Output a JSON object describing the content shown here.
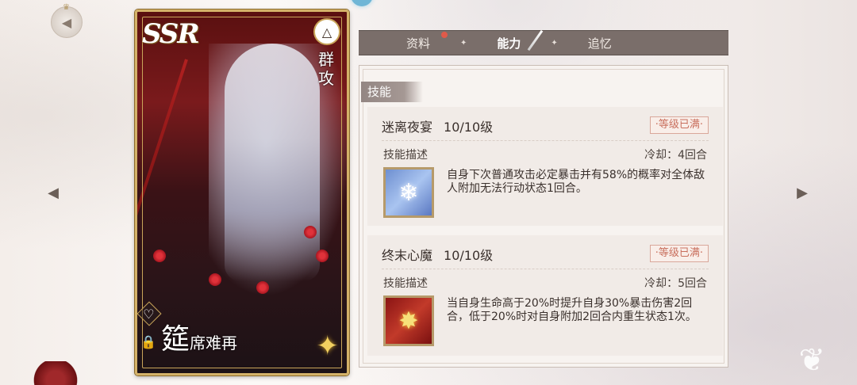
{
  "nav": {
    "back_icon": "back-arrow-icon",
    "prev_icon": "prev-arrow-icon",
    "next_icon": "next-arrow-icon",
    "back_glyph": "◀",
    "prev_glyph": "◀",
    "next_glyph": "▶"
  },
  "card": {
    "rarity": "SSR",
    "attack_type": "群攻",
    "name_big": "筵",
    "name_small": "席难再",
    "type_glyph": "△",
    "heart_glyph": "♡",
    "lock_glyph": "🔒",
    "star_glyph": "✦",
    "frame_color": "#d4b269"
  },
  "tabs": [
    {
      "label": "资料",
      "active": false,
      "has_dot": true
    },
    {
      "label": "能力",
      "active": true,
      "has_dot": false
    },
    {
      "label": "追忆",
      "active": false,
      "has_dot": false
    }
  ],
  "tab_separator": "✦",
  "panel": {
    "section_title": "技能",
    "skills": [
      {
        "name": "迷离夜宴",
        "level": "10/10级",
        "badge": "·等级已满·",
        "desc_label": "技能描述",
        "cooldown": "冷却：4回合",
        "icon": "ice-crystal-icon",
        "icon_glyph": "❄",
        "description": "自身下次普通攻击必定暴击并有58%的概率对全体敌人附加无法行动状态1回合。"
      },
      {
        "name": "终末心魔",
        "level": "10/10级",
        "badge": "·等级已满·",
        "desc_label": "技能描述",
        "cooldown": "冷却：5回合",
        "icon": "sparkle-burst-icon",
        "icon_glyph": "✸",
        "description": "当自身生命高于20%时提升自身30%暴击伤害2回合，低于20%时对自身附加2回合内重生状态1次。"
      }
    ]
  },
  "colors": {
    "tab_bar": "#7a6e6a",
    "panel_bg": "#f7f3f0",
    "badge_text": "#c9705e",
    "notification_dot": "#e05a4a"
  }
}
